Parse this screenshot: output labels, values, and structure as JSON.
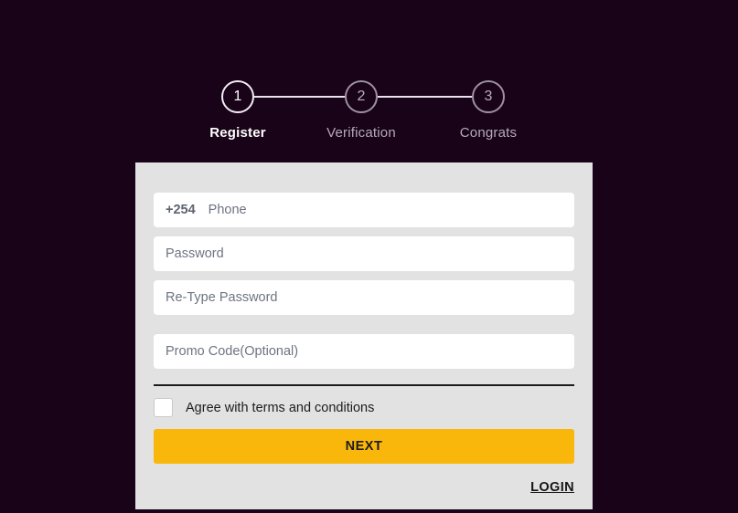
{
  "theme": {
    "page_background": "#190318",
    "card_background": "#e2e2e2",
    "accent_button": "#fab70b",
    "field_background": "#ffffff",
    "active_step_color": "#ffffff",
    "inactive_step_color": "#b6aaba"
  },
  "stepper": {
    "steps": [
      {
        "number": "1",
        "label": "Register",
        "state": "active"
      },
      {
        "number": "2",
        "label": "Verification",
        "state": "inactive"
      },
      {
        "number": "3",
        "label": "Congrats",
        "state": "inactive"
      }
    ]
  },
  "form": {
    "phone": {
      "prefix": "+254",
      "placeholder": "Phone",
      "value": ""
    },
    "password": {
      "placeholder": "Password",
      "value": ""
    },
    "retype_password": {
      "placeholder": "Re-Type Password",
      "value": ""
    },
    "promo_code": {
      "placeholder": "Promo Code(Optional)",
      "value": ""
    },
    "terms": {
      "label": "Agree with terms and conditions",
      "checked": false
    },
    "submit_label": "NEXT",
    "login_label": "LOGIN"
  }
}
